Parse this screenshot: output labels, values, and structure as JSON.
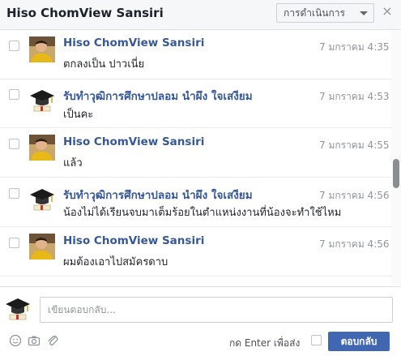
{
  "header": {
    "title": "Hiso ChomView Sansiri",
    "actions_label": "การดำเนินการ",
    "close_glyph": "×"
  },
  "messages": [
    {
      "sender": "Hiso ChomView Sansiri",
      "avatar": "yellow-shirt-profile-photo",
      "time": "7 มกราคม 4:35",
      "text": "ตกลงเป็น ปาวเนี่ย"
    },
    {
      "sender": "รับทำวุฒิการศึกษาปลอม นำผึง ใจเสงียม",
      "avatar": "graduation-cap-icon",
      "time": "7 มกราคม 4:53",
      "text": "เป็นคะ"
    },
    {
      "sender": "Hiso ChomView Sansiri",
      "avatar": "yellow-shirt-profile-photo",
      "time": "7 มกราคม 4:55",
      "text": "แล้ว"
    },
    {
      "sender": "รับทำวุฒิการศึกษาปลอม นำผึง ใจเสงียม",
      "avatar": "graduation-cap-icon",
      "time": "7 มกราคม 4:56",
      "text": "น้องไม่ได้เรียนจบมาเต็มร้อยในตำแหน่งงานที่น้องจะทำใช้ไหม"
    },
    {
      "sender": "Hiso ChomView Sansiri",
      "avatar": "yellow-shirt-profile-photo",
      "time": "7 มกราคม 4:56",
      "text": "ผมต้องเอาไปสมัครดาบ"
    }
  ],
  "composer": {
    "placeholder": "เขียนตอบกลับ...",
    "enter_to_send_label": "กด Enter เพื่อส่ง",
    "reply_button_label": "ตอบกลับ"
  },
  "colors": {
    "link_blue": "#365899",
    "button_blue": "#4267b2",
    "meta_gray": "#90949c"
  }
}
